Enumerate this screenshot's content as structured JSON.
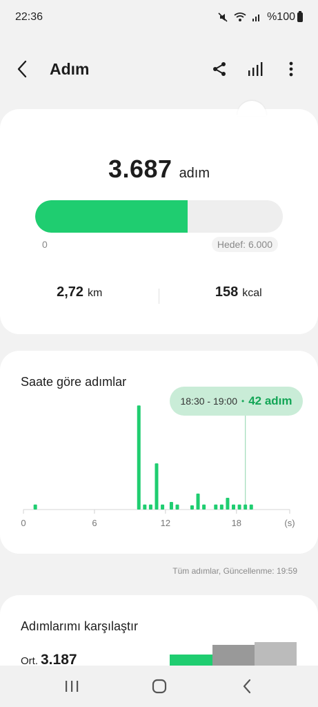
{
  "status": {
    "time": "22:36",
    "battery": "%100"
  },
  "appbar": {
    "title": "Adım",
    "icons": [
      "back-icon",
      "share-icon",
      "chart-icon",
      "more-icon"
    ]
  },
  "summary": {
    "steps": "3.687",
    "steps_unit": "adım",
    "progress": 0.6145,
    "progress_min": "0",
    "progress_goal": "Hedef: 6.000",
    "distance": "2,72",
    "distance_unit": "km",
    "calories": "158",
    "calories_unit": "kcal"
  },
  "hourly": {
    "title": "Saate göre adımlar",
    "tooltip_range": "18:30 - 19:00",
    "tooltip_value": "42 adım",
    "updated": "Tüm adımlar, Güncellenme: 19:59"
  },
  "compare": {
    "title": "Adımlarımı karşılaştır",
    "avg_prefix": "Ort.",
    "avg_value": "3.187"
  },
  "chart_data": {
    "type": "bar",
    "title": "Saate göre adımlar",
    "xlabel": "",
    "ylabel": "",
    "x_unit": "(s)",
    "xlim": [
      0,
      22.5
    ],
    "x_ticks": [
      "0",
      "6",
      "12",
      "18"
    ],
    "highlight": {
      "range": "18:30 - 19:00",
      "value": 42
    },
    "values": [
      {
        "x": 1.0,
        "v": 6
      },
      {
        "x": 9.75,
        "v": 124
      },
      {
        "x": 10.25,
        "v": 6
      },
      {
        "x": 10.75,
        "v": 6
      },
      {
        "x": 11.25,
        "v": 55
      },
      {
        "x": 11.75,
        "v": 6
      },
      {
        "x": 12.5,
        "v": 9
      },
      {
        "x": 13.0,
        "v": 6
      },
      {
        "x": 14.25,
        "v": 5
      },
      {
        "x": 14.75,
        "v": 19
      },
      {
        "x": 15.25,
        "v": 6
      },
      {
        "x": 16.25,
        "v": 6
      },
      {
        "x": 16.75,
        "v": 6
      },
      {
        "x": 17.25,
        "v": 14
      },
      {
        "x": 17.75,
        "v": 6
      },
      {
        "x": 18.25,
        "v": 6
      },
      {
        "x": 18.75,
        "v": 6
      },
      {
        "x": 19.25,
        "v": 6
      }
    ]
  },
  "colors": {
    "accent": "#1fcd70",
    "bar_gray": "#999999",
    "bar_lightgray": "#bbbbbb"
  },
  "nav": {
    "icons": [
      "recents-icon",
      "home-icon",
      "back-nav-icon"
    ]
  }
}
